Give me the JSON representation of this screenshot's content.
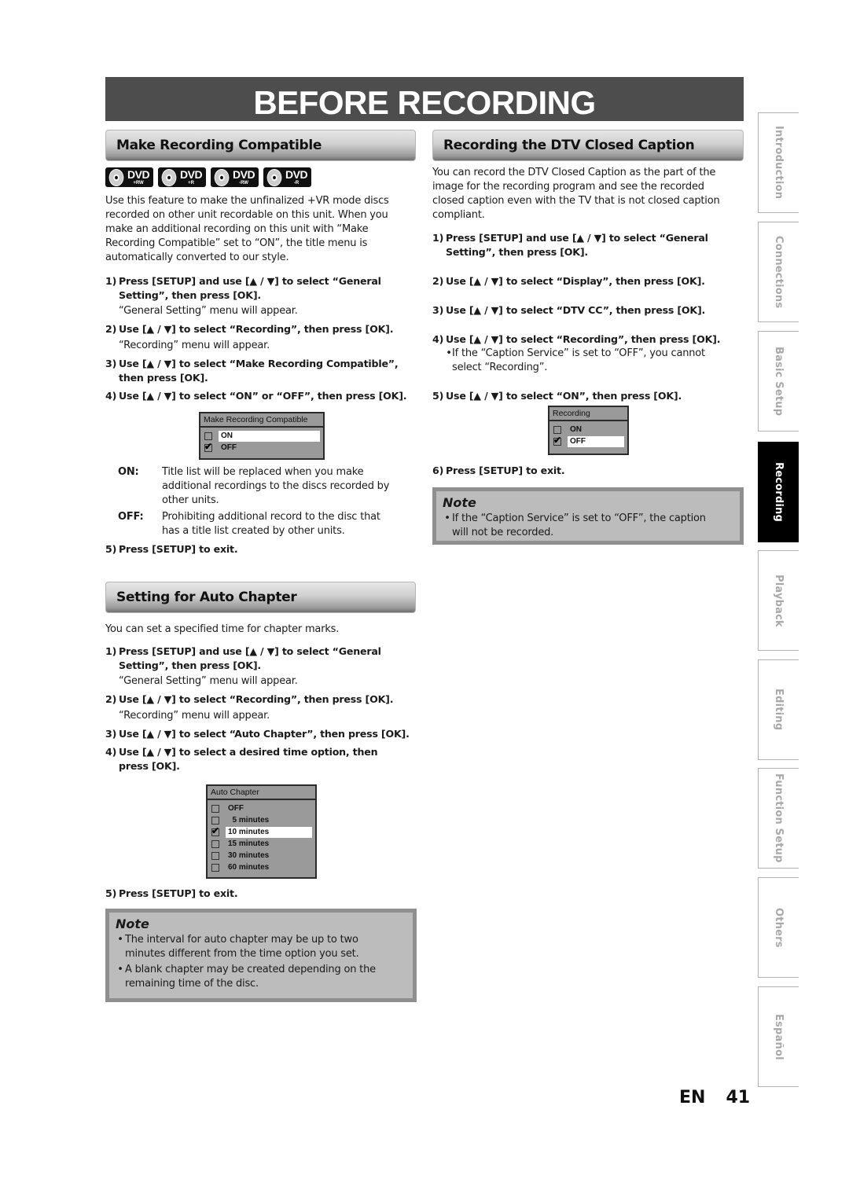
{
  "page_title": "BEFORE RECORDING",
  "sections": {
    "make_compatible": {
      "title": "Make Recording Compatible",
      "disc_badges": [
        {
          "label": "DVD",
          "sub": "+RW",
          "icon": "dvd-plus-rw-icon"
        },
        {
          "label": "DVD",
          "sub": "+R",
          "icon": "dvd-plus-r-icon"
        },
        {
          "label": "DVD",
          "sub": "-RW",
          "icon": "dvd-minus-rw-icon"
        },
        {
          "label": "DVD",
          "sub": "-R",
          "icon": "dvd-minus-r-icon"
        }
      ],
      "intro": [
        "Use this feature to make the unfinalized +VR mode discs",
        "recorded on other unit recordable on this unit. When you",
        "make an additional recording on this unit with “Make",
        "Recording Compatible” set to “ON”, the title menu is",
        "automatically converted to our style."
      ],
      "steps": [
        {
          "num": "1)",
          "lines": [
            "Press [SETUP] and use [▲ / ▼] to select “General",
            "Setting”, then press [OK]."
          ],
          "note": "“General Setting” menu will appear."
        },
        {
          "num": "2)",
          "lines": [
            "Use [▲ / ▼] to select “Recording”, then press [OK]."
          ],
          "note": "“Recording” menu will appear."
        },
        {
          "num": "3)",
          "lines": [
            "Use [▲ / ▼] to select “Make Recording Compatible”,",
            "then press [OK]."
          ]
        },
        {
          "num": "4)",
          "lines": [
            "Use [▲ / ▼] to select “ON” or “OFF”, then press [OK]."
          ]
        }
      ],
      "menu": {
        "title": "Make Recording Compatible",
        "options": [
          {
            "label": "ON",
            "checked": false,
            "highlighted": true
          },
          {
            "label": "OFF",
            "checked": true,
            "highlighted": false
          }
        ]
      },
      "definitions": [
        {
          "term": "ON:",
          "desc": [
            "Title list will be replaced when you make",
            "additional recordings to the discs recorded by",
            "other units."
          ]
        },
        {
          "term": "OFF:",
          "desc": [
            "Prohibiting additional record to the disc that",
            "has a title list created by other units."
          ]
        }
      ],
      "final_step": {
        "num": "5)",
        "text": "Press [SETUP] to exit."
      }
    },
    "auto_chapter": {
      "title": "Setting for Auto Chapter",
      "intro": "You can set a specified time for chapter marks.",
      "steps": [
        {
          "num": "1)",
          "lines": [
            "Press [SETUP] and use [▲ / ▼] to select “General",
            "Setting”, then press [OK]."
          ],
          "note": "“General Setting” menu will appear."
        },
        {
          "num": "2)",
          "lines": [
            "Use [▲ / ▼] to select “Recording”, then press [OK]."
          ],
          "note": "“Recording” menu will appear."
        },
        {
          "num": "3)",
          "lines": [
            "Use [▲ / ▼] to select “Auto Chapter”, then press [OK]."
          ]
        },
        {
          "num": "4)",
          "lines": [
            "Use [▲ / ▼] to select a desired time option, then",
            "press [OK]."
          ]
        }
      ],
      "menu": {
        "title": "Auto Chapter",
        "options": [
          {
            "label": "OFF",
            "checked": false,
            "highlighted": false
          },
          {
            "label": "  5 minutes",
            "checked": false,
            "highlighted": false
          },
          {
            "label": "10 minutes",
            "checked": true,
            "highlighted": true
          },
          {
            "label": "15 minutes",
            "checked": false,
            "highlighted": false
          },
          {
            "label": "30 minutes",
            "checked": false,
            "highlighted": false
          },
          {
            "label": "60 minutes",
            "checked": false,
            "highlighted": false
          }
        ]
      },
      "final_step": {
        "num": "5)",
        "text": "Press [SETUP] to exit."
      },
      "note": {
        "title": "Note",
        "bullets": [
          [
            "The interval for auto chapter may be up to two",
            "minutes different from the time option you set."
          ],
          [
            "A blank chapter may be created depending on the",
            "remaining time of the disc."
          ]
        ]
      }
    },
    "dtv_cc": {
      "title": "Recording the DTV Closed Caption",
      "intro": [
        "You can record the DTV Closed Caption as the part of the",
        "image for the recording program and see the recorded",
        "closed caption even with the TV that is not closed caption",
        "compliant."
      ],
      "steps": [
        {
          "num": "1)",
          "lines": [
            "Press [SETUP] and use [▲ / ▼] to select “General",
            "Setting”, then press [OK]."
          ]
        },
        {
          "num": "2)",
          "lines": [
            "Use [▲ / ▼] to select “Display”, then press [OK]."
          ]
        },
        {
          "num": "3)",
          "lines": [
            "Use [▲ / ▼] to select “DTV CC”, then press [OK]."
          ]
        },
        {
          "num": "4)",
          "lines": [
            "Use [▲ / ▼] to select “Recording”, then press [OK]."
          ],
          "bullet": [
            "If the “Caption Service” is set to “OFF”, you cannot",
            "select “Recording”."
          ]
        },
        {
          "num": "5)",
          "lines": [
            "Use [▲ / ▼] to select “ON”, then press [OK]."
          ]
        }
      ],
      "menu": {
        "title": "Recording",
        "options": [
          {
            "label": "ON",
            "checked": false,
            "highlighted": false
          },
          {
            "label": "OFF",
            "checked": true,
            "highlighted": true
          }
        ]
      },
      "final_step": {
        "num": "6)",
        "text": "Press [SETUP] to exit."
      },
      "note": {
        "title": "Note",
        "bullets": [
          [
            "If the “Caption Service” is set to “OFF”, the caption",
            "will not be recorded."
          ]
        ]
      }
    }
  },
  "side_tabs": [
    {
      "label": "Introduction",
      "active": false
    },
    {
      "label": "Connections",
      "active": false
    },
    {
      "label": "Basic Setup",
      "active": false
    },
    {
      "label": "Recording",
      "active": true
    },
    {
      "label": "Playback",
      "active": false
    },
    {
      "label": "Editing",
      "active": false
    },
    {
      "label": "Function Setup",
      "active": false
    },
    {
      "label": "Others",
      "active": false
    },
    {
      "label": "Español",
      "active": false
    }
  ],
  "footer": {
    "lang": "EN",
    "page": "41"
  }
}
